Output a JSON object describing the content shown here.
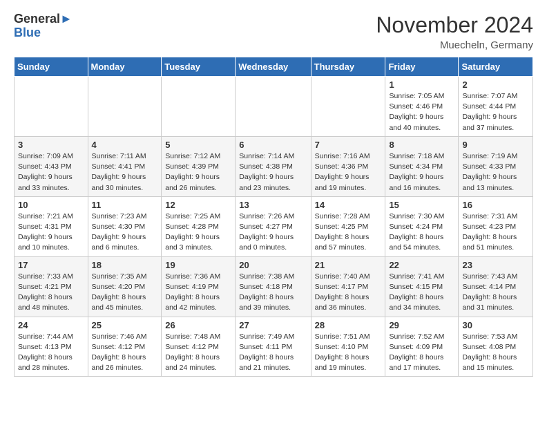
{
  "header": {
    "logo_general": "General",
    "logo_blue": "Blue",
    "month_title": "November 2024",
    "location": "Muecheln, Germany"
  },
  "weekdays": [
    "Sunday",
    "Monday",
    "Tuesday",
    "Wednesday",
    "Thursday",
    "Friday",
    "Saturday"
  ],
  "weeks": [
    [
      {
        "day": "",
        "info": ""
      },
      {
        "day": "",
        "info": ""
      },
      {
        "day": "",
        "info": ""
      },
      {
        "day": "",
        "info": ""
      },
      {
        "day": "",
        "info": ""
      },
      {
        "day": "1",
        "info": "Sunrise: 7:05 AM\nSunset: 4:46 PM\nDaylight: 9 hours\nand 40 minutes."
      },
      {
        "day": "2",
        "info": "Sunrise: 7:07 AM\nSunset: 4:44 PM\nDaylight: 9 hours\nand 37 minutes."
      }
    ],
    [
      {
        "day": "3",
        "info": "Sunrise: 7:09 AM\nSunset: 4:43 PM\nDaylight: 9 hours\nand 33 minutes."
      },
      {
        "day": "4",
        "info": "Sunrise: 7:11 AM\nSunset: 4:41 PM\nDaylight: 9 hours\nand 30 minutes."
      },
      {
        "day": "5",
        "info": "Sunrise: 7:12 AM\nSunset: 4:39 PM\nDaylight: 9 hours\nand 26 minutes."
      },
      {
        "day": "6",
        "info": "Sunrise: 7:14 AM\nSunset: 4:38 PM\nDaylight: 9 hours\nand 23 minutes."
      },
      {
        "day": "7",
        "info": "Sunrise: 7:16 AM\nSunset: 4:36 PM\nDaylight: 9 hours\nand 19 minutes."
      },
      {
        "day": "8",
        "info": "Sunrise: 7:18 AM\nSunset: 4:34 PM\nDaylight: 9 hours\nand 16 minutes."
      },
      {
        "day": "9",
        "info": "Sunrise: 7:19 AM\nSunset: 4:33 PM\nDaylight: 9 hours\nand 13 minutes."
      }
    ],
    [
      {
        "day": "10",
        "info": "Sunrise: 7:21 AM\nSunset: 4:31 PM\nDaylight: 9 hours\nand 10 minutes."
      },
      {
        "day": "11",
        "info": "Sunrise: 7:23 AM\nSunset: 4:30 PM\nDaylight: 9 hours\nand 6 minutes."
      },
      {
        "day": "12",
        "info": "Sunrise: 7:25 AM\nSunset: 4:28 PM\nDaylight: 9 hours\nand 3 minutes."
      },
      {
        "day": "13",
        "info": "Sunrise: 7:26 AM\nSunset: 4:27 PM\nDaylight: 9 hours\nand 0 minutes."
      },
      {
        "day": "14",
        "info": "Sunrise: 7:28 AM\nSunset: 4:25 PM\nDaylight: 8 hours\nand 57 minutes."
      },
      {
        "day": "15",
        "info": "Sunrise: 7:30 AM\nSunset: 4:24 PM\nDaylight: 8 hours\nand 54 minutes."
      },
      {
        "day": "16",
        "info": "Sunrise: 7:31 AM\nSunset: 4:23 PM\nDaylight: 8 hours\nand 51 minutes."
      }
    ],
    [
      {
        "day": "17",
        "info": "Sunrise: 7:33 AM\nSunset: 4:21 PM\nDaylight: 8 hours\nand 48 minutes."
      },
      {
        "day": "18",
        "info": "Sunrise: 7:35 AM\nSunset: 4:20 PM\nDaylight: 8 hours\nand 45 minutes."
      },
      {
        "day": "19",
        "info": "Sunrise: 7:36 AM\nSunset: 4:19 PM\nDaylight: 8 hours\nand 42 minutes."
      },
      {
        "day": "20",
        "info": "Sunrise: 7:38 AM\nSunset: 4:18 PM\nDaylight: 8 hours\nand 39 minutes."
      },
      {
        "day": "21",
        "info": "Sunrise: 7:40 AM\nSunset: 4:17 PM\nDaylight: 8 hours\nand 36 minutes."
      },
      {
        "day": "22",
        "info": "Sunrise: 7:41 AM\nSunset: 4:15 PM\nDaylight: 8 hours\nand 34 minutes."
      },
      {
        "day": "23",
        "info": "Sunrise: 7:43 AM\nSunset: 4:14 PM\nDaylight: 8 hours\nand 31 minutes."
      }
    ],
    [
      {
        "day": "24",
        "info": "Sunrise: 7:44 AM\nSunset: 4:13 PM\nDaylight: 8 hours\nand 28 minutes."
      },
      {
        "day": "25",
        "info": "Sunrise: 7:46 AM\nSunset: 4:12 PM\nDaylight: 8 hours\nand 26 minutes."
      },
      {
        "day": "26",
        "info": "Sunrise: 7:48 AM\nSunset: 4:12 PM\nDaylight: 8 hours\nand 24 minutes."
      },
      {
        "day": "27",
        "info": "Sunrise: 7:49 AM\nSunset: 4:11 PM\nDaylight: 8 hours\nand 21 minutes."
      },
      {
        "day": "28",
        "info": "Sunrise: 7:51 AM\nSunset: 4:10 PM\nDaylight: 8 hours\nand 19 minutes."
      },
      {
        "day": "29",
        "info": "Sunrise: 7:52 AM\nSunset: 4:09 PM\nDaylight: 8 hours\nand 17 minutes."
      },
      {
        "day": "30",
        "info": "Sunrise: 7:53 AM\nSunset: 4:08 PM\nDaylight: 8 hours\nand 15 minutes."
      }
    ]
  ]
}
